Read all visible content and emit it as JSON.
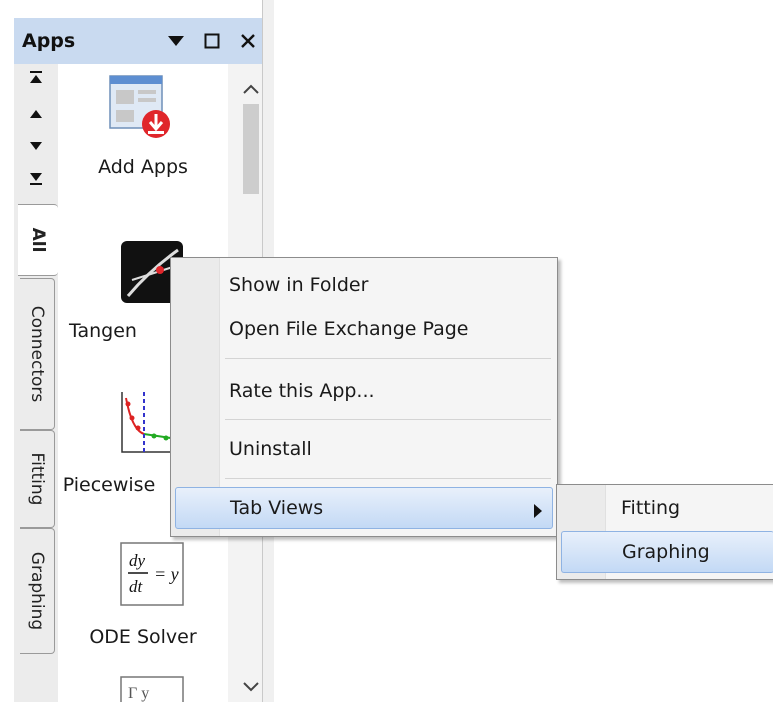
{
  "panel": {
    "title": "Apps",
    "controls": {
      "dropdown_icon": "triangle-down-icon",
      "maximize_icon": "square-icon",
      "close_icon": "close-icon"
    }
  },
  "nav_arrows": [
    "scroll-first-icon",
    "scroll-up-icon",
    "scroll-down-icon",
    "scroll-last-icon"
  ],
  "tabs": [
    {
      "label": "All",
      "active": true
    },
    {
      "label": "Connectors",
      "active": false
    },
    {
      "label": "Fitting",
      "active": false
    },
    {
      "label": "Graphing",
      "active": false
    }
  ],
  "apps": [
    {
      "label": "Add Apps",
      "icon": "add-apps-icon"
    },
    {
      "label": "Tangen",
      "icon": "tangent-icon"
    },
    {
      "label": "Piecewise",
      "icon": "piecewise-fit-icon"
    },
    {
      "label": "ODE Solver",
      "icon": "ode-solver-icon"
    },
    {
      "label": "",
      "icon": "app-icon-partial"
    }
  ],
  "context_menu": {
    "items": [
      {
        "label": "Show in Folder"
      },
      {
        "label": "Open File Exchange Page"
      },
      {
        "label": "Rate this App..."
      },
      {
        "label": "Uninstall"
      },
      {
        "label": "Tab Views",
        "has_submenu": true,
        "highlighted": true
      }
    ]
  },
  "submenu": {
    "items": [
      {
        "label": "Fitting",
        "highlighted": false
      },
      {
        "label": "Graphing",
        "highlighted": true
      }
    ]
  },
  "colors": {
    "titlebar": "#c9daf0",
    "highlight": "#c3d9f5",
    "accent_red": "#e0262b"
  }
}
